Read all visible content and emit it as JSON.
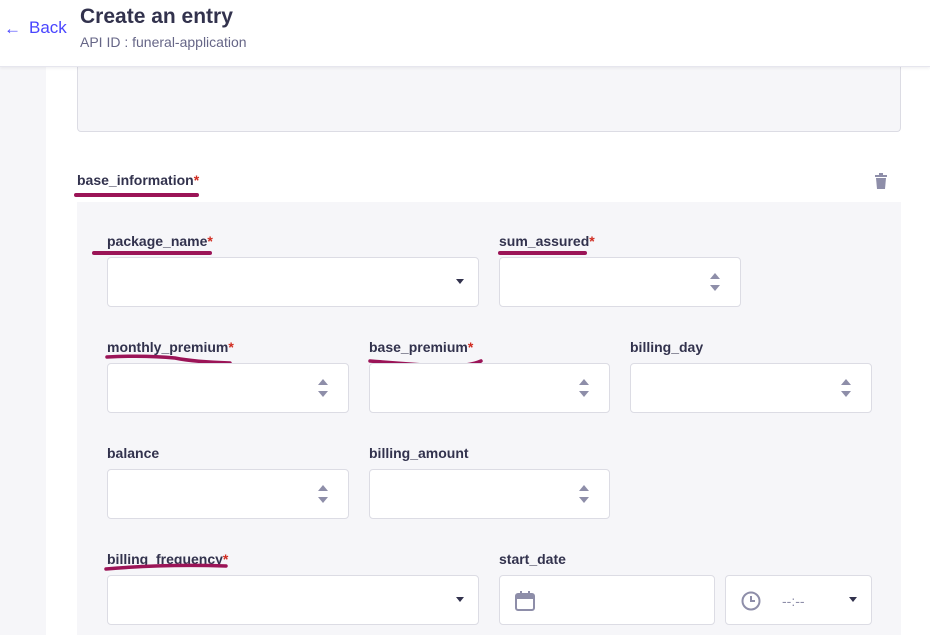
{
  "header": {
    "back_label": "Back",
    "title": "Create an entry",
    "api_id": "API ID : funeral-application"
  },
  "section": {
    "label": "base_information",
    "required_mark": "*"
  },
  "fields": {
    "package_name": {
      "label": "package_name",
      "required": "*",
      "value": ""
    },
    "sum_assured": {
      "label": "sum_assured",
      "required": "*",
      "value": ""
    },
    "monthly_premium": {
      "label": "monthly_premium",
      "required": "*",
      "value": ""
    },
    "base_premium": {
      "label": "base_premium",
      "required": "*",
      "value": ""
    },
    "billing_day": {
      "label": "billing_day",
      "value": ""
    },
    "balance": {
      "label": "balance",
      "value": ""
    },
    "billing_amount": {
      "label": "billing_amount",
      "value": ""
    },
    "billing_frequency": {
      "label": "billing_frequency",
      "required": "*",
      "value": ""
    },
    "start_date": {
      "label": "start_date",
      "date_value": "",
      "time_placeholder": "--:--"
    }
  },
  "icons": {
    "back": "arrow-left-icon",
    "trash": "trash-icon",
    "calendar": "calendar-icon",
    "clock": "clock-icon",
    "caret": "chevron-down-icon",
    "stepper": "stepper-icon"
  },
  "colors": {
    "accent": "#4945ff",
    "required": "#d02b20",
    "annotation": "#9b1457",
    "text": "#32324d",
    "muted": "#666687"
  }
}
